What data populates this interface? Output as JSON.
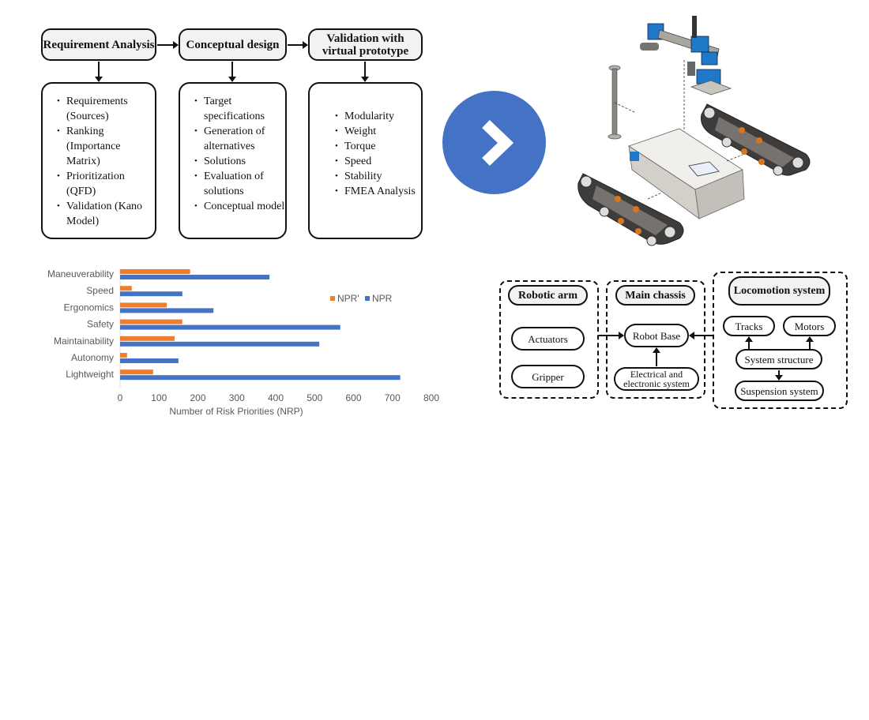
{
  "process": {
    "stages": [
      {
        "title": "Requirement Analysis",
        "items": [
          "Requirements (Sources)",
          "Ranking (Importance Matrix)",
          "Prioritization (QFD)",
          "Validation (Kano Model)"
        ]
      },
      {
        "title": "Conceptual design",
        "items": [
          "Target specifications",
          "Generation of alternatives",
          "Solutions",
          "Evaluation of solutions",
          "Conceptual model"
        ]
      },
      {
        "title": "Validation with virtual prototype",
        "items": [
          "Modularity",
          "Weight",
          "Torque",
          "Speed",
          "Stability",
          "FMEA Analysis"
        ]
      }
    ]
  },
  "next_button": {
    "icon": "chevron-right-icon",
    "color": "#4472c4"
  },
  "robot_image": {
    "description": "Exploded CAD view of tracked mobile robot with robotic arm, mast, main chassis and two track modules"
  },
  "architecture": {
    "robotic_arm": {
      "title": "Robotic arm",
      "components": [
        "Actuators",
        "Gripper"
      ]
    },
    "main_chassis": {
      "title": "Main chassis",
      "components": [
        "Robot Base",
        "Electrical and electronic system"
      ]
    },
    "locomotion": {
      "title": "Locomotion system",
      "components": [
        "Tracks",
        "Motors",
        "System structure",
        "Suspension system"
      ]
    }
  },
  "chart_data": {
    "type": "bar",
    "orientation": "horizontal",
    "categories": [
      "Maneuverability",
      "Speed",
      "Ergonomics",
      "Safety",
      "Maintainability",
      "Autonomy",
      "Lightweight"
    ],
    "series": [
      {
        "name": "NPR'",
        "color": "#ed7d31",
        "values": [
          180,
          30,
          120,
          160,
          140,
          18,
          85
        ]
      },
      {
        "name": "NPR",
        "color": "#4472c4",
        "values": [
          384,
          160,
          240,
          566,
          512,
          150,
          720
        ]
      }
    ],
    "title": "",
    "xlabel": "Number of Risk Priorities (NRP)",
    "ylabel": "",
    "xlim": [
      0,
      800
    ],
    "xticks": [
      0,
      100,
      200,
      300,
      400,
      500,
      600,
      700,
      800
    ],
    "grid": false,
    "legend": "right"
  }
}
